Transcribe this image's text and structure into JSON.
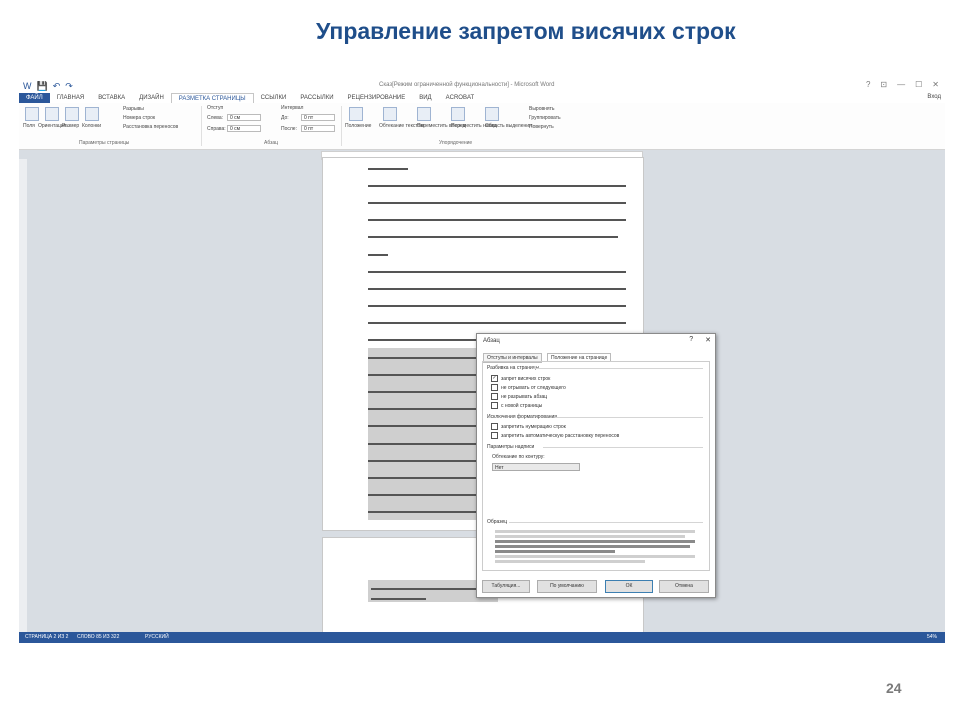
{
  "slide": {
    "title": "Управление запретом висячих строк",
    "page_number": "24"
  },
  "word": {
    "qat": [
      "W",
      "💾",
      "↶",
      "↷"
    ],
    "doc_title": "Сказ[Режим ограниченной функциональности] - Microsoft Word",
    "window_controls": [
      "?",
      "⊡",
      "—",
      "☐",
      "✕"
    ],
    "tabs": [
      "ФАЙЛ",
      "ГЛАВНАЯ",
      "ВСТАВКА",
      "ДИЗАЙН",
      "РАЗМЕТКА СТРАНИЦЫ",
      "ССЫЛКИ",
      "РАССЫЛКИ",
      "РЕЦЕНЗИРОВАНИЕ",
      "ВИД",
      "ACROBAT"
    ],
    "active_tab": "РАЗМЕТКА СТРАНИЦЫ",
    "user": "Вход",
    "ribbon": {
      "page_setup_buttons": [
        "Поля",
        "Ориентация",
        "Размер",
        "Колонки"
      ],
      "page_setup_small": [
        "Разрывы",
        "Номера строк",
        "Расстановка переносов"
      ],
      "page_setup_label": "Параметры страницы",
      "indent_header": "Отступ",
      "spacing_header": "Интервал",
      "indent_left_label": "Слева:",
      "indent_left_value": "0 см",
      "indent_right_label": "Справа:",
      "indent_right_value": "0 см",
      "spacing_before_label": "До:",
      "spacing_before_value": "0 пт",
      "spacing_after_label": "После:",
      "spacing_after_value": "0 пт",
      "paragraph_label": "Абзац",
      "arrange_buttons": [
        "Положение",
        "Обтекание текстом",
        "Переместить вперед",
        "Переместить назад",
        "Область выделения"
      ],
      "arrange_small": [
        "Выровнять",
        "Группировать",
        "Повернуть"
      ],
      "arrange_label": "Упорядочение"
    },
    "status": {
      "page": "СТРАНИЦА 2 ИЗ 2",
      "words": "СЛОВО 85 ИЗ 322",
      "lang": "РУССКИЙ",
      "zoom": "54%"
    }
  },
  "dialog": {
    "title": "Абзац",
    "controls": [
      "?",
      "✕"
    ],
    "tabs": [
      "Отступы и интервалы",
      "Положение на странице"
    ],
    "active_tab": "Положение на странице",
    "pagination_header": "Разбивка на страницы",
    "pagination": [
      {
        "label": "запрет висячих строк",
        "checked": true
      },
      {
        "label": "не отрывать от следующего",
        "checked": false
      },
      {
        "label": "не разрывать абзац",
        "checked": false
      },
      {
        "label": "с новой страницы",
        "checked": false
      }
    ],
    "exceptions_header": "Исключения форматирования",
    "exceptions": [
      {
        "label": "запретить нумерацию строк",
        "checked": false
      },
      {
        "label": "запретить автоматическую расстановку переносов",
        "checked": false
      }
    ],
    "textbox_header": "Параметры надписи",
    "wrap_label": "Обтекание по контуру:",
    "wrap_value": "Нет",
    "sample_header": "Образец",
    "buttons": {
      "tabs": "Табуляция...",
      "default": "По умолчанию",
      "ok": "ОК",
      "cancel": "Отмена"
    }
  },
  "colors": {
    "title": "#1f4e8a",
    "word_accent": "#2b579a",
    "selection": "#cfcfcf"
  }
}
